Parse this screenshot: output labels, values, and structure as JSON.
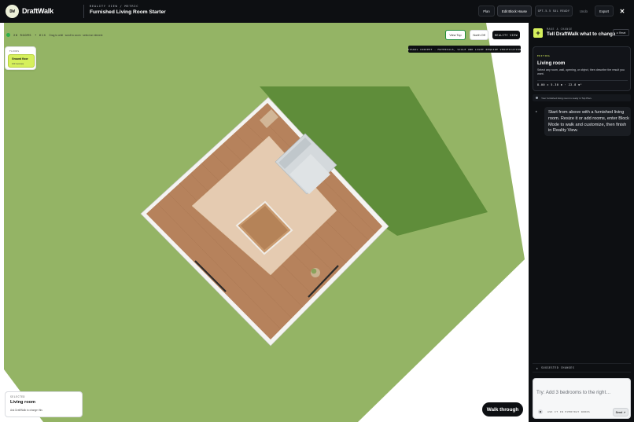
{
  "header": {
    "logo_initials": "DW",
    "brand": "DraftWalk",
    "breadcrumb": "Reality View / Metric",
    "project_title": "Furnished Living Room Starter",
    "buttons": {
      "plan": "Plan",
      "edit_block": "Edit Block House",
      "status": "GPT-5.5 sol ready",
      "undo": "Undo",
      "export": "Export"
    },
    "close_icon": "close-icon"
  },
  "canvas": {
    "room_count": "20 rooms",
    "size_glyph": "• 61x",
    "hint": "Drag to orbit · scroll to zoom · select an element",
    "view_top": "View Top",
    "north_off": "North Off",
    "reality_view": "Reality view",
    "banner": "Visual concept · materials, scale and light require verification",
    "floors": {
      "label": "Floors",
      "items": [
        {
          "name": "Ground floor",
          "sub": "100 rooms(s)"
        }
      ]
    },
    "selected": {
      "label": "Selected",
      "name": "Living room",
      "hint": "Ask DraftWalk to change this"
    },
    "walk_through": "Walk through",
    "colors": {
      "grass": "#94b465",
      "shadow": "#5f8d3a",
      "wall": "#f4f4f2",
      "wood": "#b6825c",
      "rug": "#e5cbb1",
      "sofa": "#d4d9dc"
    }
  },
  "panel": {
    "kicker": "Make a change",
    "title": "Tell DraftWalk what to change",
    "reset": "⊘ Reset",
    "editing": {
      "kicker": "Editing",
      "title": "Living room",
      "description": "Select any room, wall, opening, or object, then describe the result you want.",
      "dimensions": "8.00 × 5.30 m · 22.8 m²"
    },
    "note": "Your furnished living room is ready in Top Plan.",
    "message": "Start from above with a furnished living room. Resize it or add rooms, enter Block Mode to walk and customize, then finish in Reality View.",
    "suggested": "Suggested changes",
    "composer": {
      "placeholder": "Try: Add 3 bedrooms to the right…",
      "hint": "Ask it in everyday words",
      "send": "Send ↗"
    }
  }
}
